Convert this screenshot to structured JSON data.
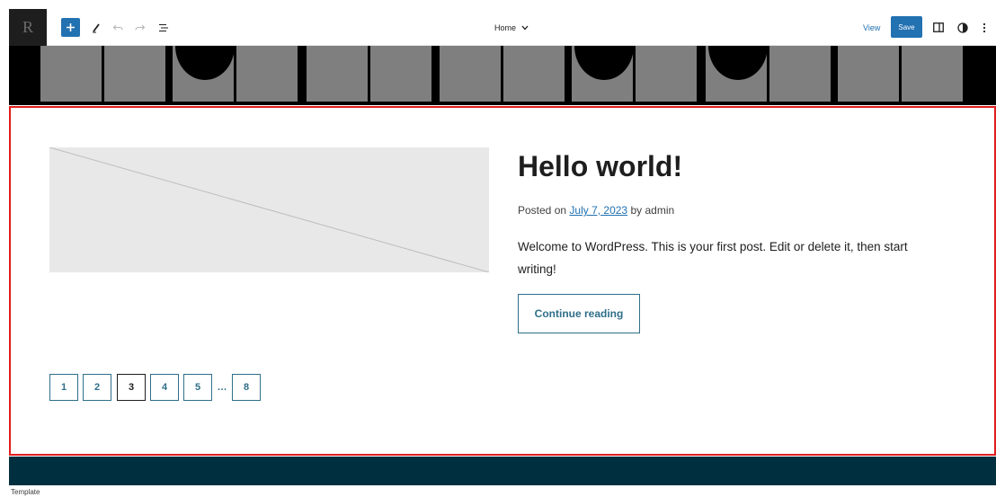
{
  "toolbar": {
    "logo_glyph": "R",
    "add_icon": "plus-icon",
    "tools_icon": "pencil-icon",
    "undo_icon": "undo-icon",
    "redo_icon": "redo-icon",
    "list_view_icon": "list-view-icon",
    "document_title": "Home",
    "view_label": "View",
    "save_label": "Save",
    "settings_icon": "sidebar-toggle-icon",
    "styles_icon": "half-circle-icon",
    "options_icon": "more-vertical-icon"
  },
  "post": {
    "title": "Hello world!",
    "meta_prefix": "Posted on",
    "meta_date": "July 7, 2023",
    "meta_by": "by",
    "meta_author": "admin",
    "excerpt": "Welcome to WordPress. This is your first post. Edit or delete it, then start writing!",
    "continue_label": "Continue reading"
  },
  "pagination": {
    "pages": [
      "1",
      "2",
      "3",
      "4",
      "5"
    ],
    "current": "3",
    "ellipsis": "…",
    "last": "8"
  },
  "status_bar": {
    "label": "Template"
  },
  "colors": {
    "accent": "#2271b1",
    "selection_border": "#e01d1d",
    "footer": "#002f3f",
    "button_border": "#2f6f89"
  }
}
